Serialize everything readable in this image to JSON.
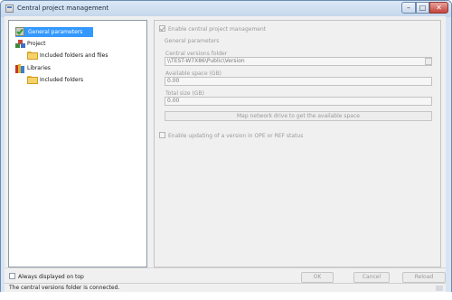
{
  "window": {
    "title": "Central project management"
  },
  "tree": {
    "items": [
      {
        "label": "General parameters",
        "icon": "general-parameters-icon",
        "selected": true
      },
      {
        "label": "Project",
        "icon": "project-icon"
      },
      {
        "label": "Included folders and files",
        "icon": "folder-icon"
      },
      {
        "label": "Libraries",
        "icon": "libraries-icon"
      },
      {
        "label": "Included folders",
        "icon": "folder-icon"
      }
    ]
  },
  "general": {
    "enable_label": "Enable central project management",
    "enable_checked": true,
    "section_title": "General parameters",
    "versions_folder_label": "Central versions folder",
    "versions_folder_value": "\\\\TEST-W7X86\\Public\\Version",
    "available_space_label": "Available space (GB)",
    "available_space_value": "0.00",
    "total_size_label": "Total size (GB)",
    "total_size_value": "0.00",
    "map_button": "Map network drive to get the available space",
    "enable_updating_label": "Enable updating of a version in OPE or REF status",
    "enable_updating_checked": false
  },
  "footer": {
    "always_on_top_label": "Always displayed on top",
    "ok": "OK",
    "cancel": "Cancel",
    "reload": "Reload"
  },
  "status": {
    "text": "The central versions folder is connected."
  }
}
